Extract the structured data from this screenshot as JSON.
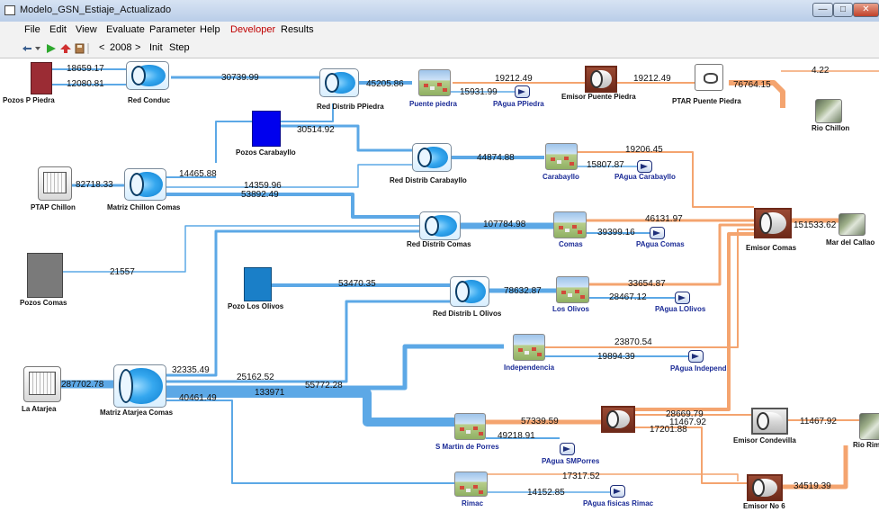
{
  "window": {
    "title": "Modelo_GSN_Estiaje_Actualizado"
  },
  "menu": [
    "File",
    "Edit",
    "View",
    "Evaluate",
    "Parameter",
    "Help",
    "Developer",
    "Results"
  ],
  "colors": {
    "menu_developer": "#c00000",
    "node_label_blue": "#1a2a96",
    "supply_flow": "#5ca8e6",
    "return_flow": "#f4a46f"
  },
  "toolbar": {
    "prev": "<",
    "year": "2008",
    "next": ">",
    "init": "Init",
    "step": "Step"
  },
  "nodes": {
    "pozos_p_piedra": "Pozos P Piedra",
    "red_conduc": "Red Conduc",
    "red_distrib_ppiedra": "Red Distrib PPiedra",
    "puente_piedra": "Puente piedra",
    "pagua_ppiedra": "PAgua PPiedra",
    "emisor_puente_piedra": "Emisor Puente Piedra",
    "ptar_puente_piedra": "PTAR Puente Piedra",
    "rio_chillon": "Rio Chillon",
    "pozos_carabayllo": "Pozos Carabayllo",
    "red_distrib_carabayllo": "Red Distrib Carabayllo",
    "carabayllo": "Carabayllo",
    "pagua_carabayllo": "PAgua Carabayllo",
    "ptap_chillon": "PTAP Chillon",
    "matriz_chillon_comas": "Matriz Chillon Comas",
    "red_distrib_comas": "Red Distrib Comas",
    "comas": "Comas",
    "pagua_comas": "PAgua Comas",
    "emisor_comas": "Emisor Comas",
    "mar_del_callao": "Mar del Callao",
    "pozos_comas": "Pozos Comas",
    "pozo_los_olivos": "Pozo Los Olivos",
    "red_distrib_l_olivos": "Red Distrib L Olivos",
    "los_olivos": "Los Olivos",
    "pagua_lolivos": "PAgua LOlivos",
    "independencia": "Independencia",
    "pagua_independ": "PAgua Independ",
    "la_atarjea": "La Atarjea",
    "matriz_atarjea_comas": "Matriz Atarjea Comas",
    "s_martin_de_porres": "S Martin de Porres",
    "pagua_smporres": "PAgua SMPorres",
    "emisor_condevilla": "Emisor Condevilla",
    "rio_rimac": "Rio Rim",
    "rimac": "Rimac",
    "pagua_fisicas_rimac": "PAgua fisicas Rimac",
    "emisor_no6": "Emisor No 6"
  },
  "flows": {
    "pozos_pp_top": "18659.17",
    "pozos_pp_bot": "12080.81",
    "red_conduc_out": "30739.99",
    "ppiedra_in": "45205.86",
    "pp_return": "19212.49",
    "pp_pagua": "15931.99",
    "emisor_pp_out": "19212.49",
    "ptar_out": "76764.15",
    "far_right_top": "4.22",
    "pozos_carab_out": "30514.92",
    "carab_in": "44874.88",
    "carab_return": "19206.45",
    "carab_pagua": "15807.87",
    "ptap_out": "82718.33",
    "matriz_up": "14465.88",
    "matriz_mid": "14359.96",
    "matriz_low": "53892.49",
    "comas_in": "107784.98",
    "comas_return": "46131.97",
    "comas_pagua": "39399.16",
    "emisor_comas_out": "151533.62",
    "pozos_comas_out": "21557",
    "olivos_pozo": "53470.35",
    "olivos_in": "78632.87",
    "olivos_return": "33654.87",
    "olivos_pagua": "28467.12",
    "indep_return": "23870.54",
    "indep_pagua": "19894.39",
    "atarjea_out": "287702.78",
    "matriz_atarjea_up": "32335.49",
    "atarjea_a": "25162.52",
    "atarjea_b": "55772.28",
    "atarjea_c": "133971",
    "atarjea_d": "40461.49",
    "smp_return": "57339.59",
    "smp_pagua": "49218.91",
    "emisor_c_in": "28669.79",
    "emisor_c_in2": "11467.92",
    "emisor_c_branch": "17201.88",
    "condevilla_out": "11467.92",
    "rimac_return": "17317.52",
    "rimac_pagua": "14152.85",
    "emisor6_out": "34519.39"
  }
}
